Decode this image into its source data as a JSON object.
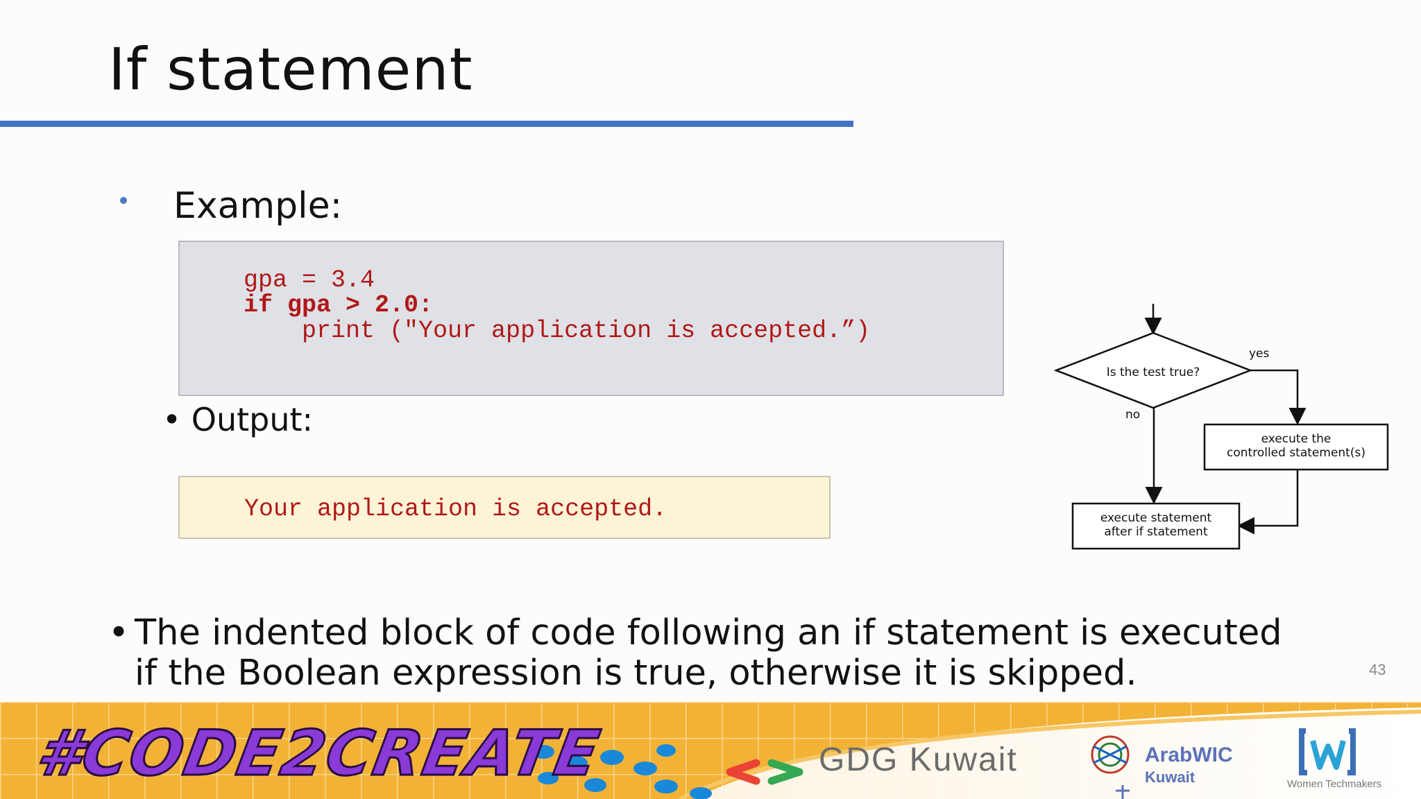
{
  "slide": {
    "title": "If statement",
    "example_label": "Example:",
    "code": {
      "line1": "gpa = 3.4",
      "line2": "if gpa > 2.0:",
      "line3": "    print (\"Your application is accepted.”)"
    },
    "output_label": "Output:",
    "output_text": "Your application is accepted.",
    "explanation": "The indented block of code following an if statement is executed if the Boolean expression is true, otherwise it is skipped.",
    "page_number": "43"
  },
  "flowchart": {
    "decision": "Is the test true?",
    "yes_label": "yes",
    "no_label": "no",
    "controlled_line1": "execute the",
    "controlled_line2": "controlled statement(s)",
    "after_line1": "execute statement",
    "after_line2": "after if statement"
  },
  "footer": {
    "hashtag": "#CODE2CREATE",
    "gdg": "GDG Kuwait",
    "arabwic": "ArabWIC",
    "arabwic_sub": "Kuwait",
    "wtm": "Women Techmakers"
  },
  "colors": {
    "accent_rule": "#4472c4",
    "code_text": "#b01818",
    "code_bg": "#dfe1e6",
    "output_bg": "#fdf3d6",
    "banner_yellow": "#f2b236"
  }
}
